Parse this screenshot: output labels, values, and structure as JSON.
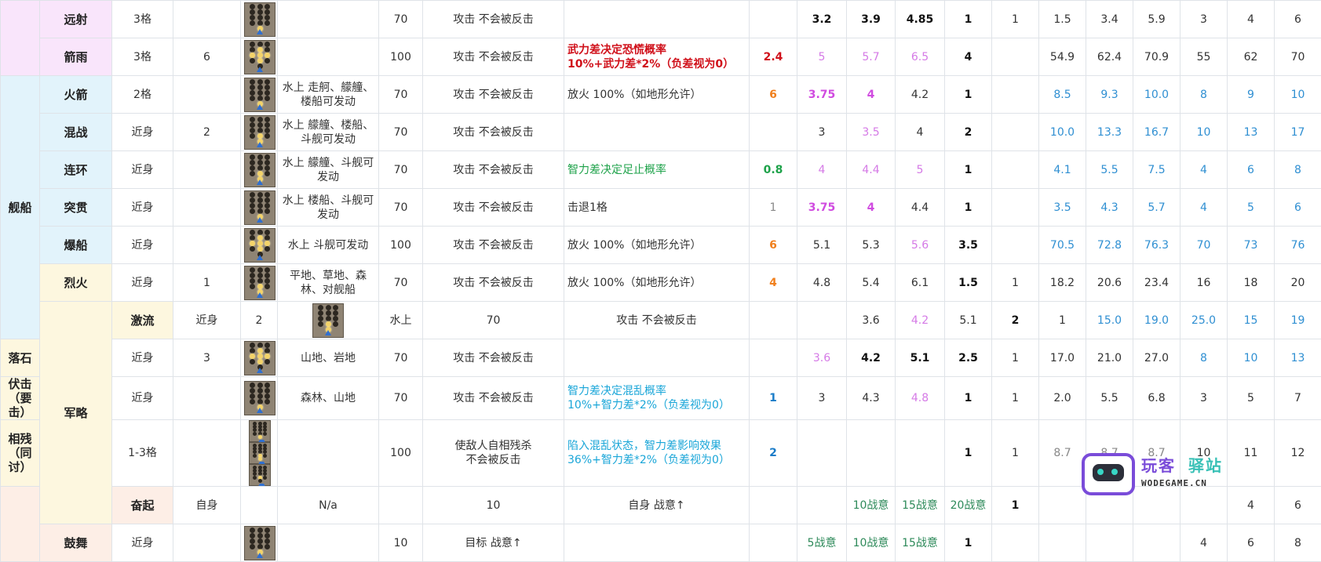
{
  "rows": [
    {
      "cat": "",
      "cat_span": 0,
      "name": "远射",
      "range": "3格",
      "v": "",
      "terr": "",
      "cost": "70",
      "eff": "攻击 不会被反击",
      "desc": "",
      "desc_color": "c-default",
      "coef": "",
      "coef_color": "c-default",
      "a": "3.2",
      "a_c": "c-bold",
      "b": "3.9",
      "b_c": "c-bold",
      "c": "4.85",
      "c_c": "c-bold",
      "d": "1",
      "e": "1",
      "f": "1.5",
      "f_c": "c-dark",
      "g": "3.4",
      "g_c": "c-dark",
      "h": "5.9",
      "h_c": "c-dark",
      "i": "3",
      "i_c": "c-dark",
      "j": "4",
      "j_c": "c-dark",
      "k": "6",
      "k_c": "c-dark",
      "bg": "pink",
      "img": "std"
    },
    {
      "cat": "",
      "cat_span": 0,
      "name": "箭雨",
      "range": "3格",
      "v": "6",
      "terr": "",
      "cost": "100",
      "eff": "攻击 不会被反击",
      "desc": "武力差决定恐慌概率\n10%+武力差*2%（负差视为0）",
      "desc_color": "c-red",
      "coef": "2.4",
      "coef_color": "c-red2",
      "a": "5",
      "a_c": "c-violet",
      "b": "5.7",
      "b_c": "c-violet",
      "c": "6.5",
      "c_c": "c-violet",
      "d": "4",
      "e": "",
      "f": "54.9",
      "f_c": "c-dark",
      "g": "62.4",
      "g_c": "c-dark",
      "h": "70.9",
      "h_c": "c-dark",
      "i": "55",
      "i_c": "c-dark",
      "j": "62",
      "j_c": "c-dark",
      "k": "70",
      "k_c": "c-dark",
      "bg": "pink",
      "img": "rain"
    },
    {
      "cat": "舰船",
      "cat_span": 7,
      "name": "火箭",
      "range": "2格",
      "v": "",
      "terr": "水上 走舸、艨艟、楼船可发动",
      "cost": "70",
      "eff": "攻击 不会被反击",
      "desc": "放火 100%（如地形允许）",
      "desc_color": "c-default",
      "coef": "6",
      "coef_color": "c-orange",
      "a": "3.75",
      "a_c": "c-violetb",
      "b": "4",
      "b_c": "c-violetb",
      "c": "4.2",
      "c_c": "c-dark",
      "d": "1",
      "e": "",
      "f": "8.5",
      "f_c": "c-blue",
      "g": "9.3",
      "g_c": "c-blue",
      "h": "10.0",
      "h_c": "c-blue",
      "i": "8",
      "i_c": "c-blue",
      "j": "9",
      "j_c": "c-blue",
      "k": "10",
      "k_c": "c-blue",
      "bg": "blue",
      "img": "std"
    },
    {
      "cat": "",
      "cat_span": 0,
      "name": "混战",
      "range": "近身",
      "v": "2",
      "terr": "水上 艨艟、楼船、斗舰可发动",
      "cost": "70",
      "eff": "攻击 不会被反击",
      "desc": "",
      "desc_color": "c-default",
      "coef": "",
      "coef_color": "c-default",
      "a": "3",
      "a_c": "c-dark",
      "b": "3.5",
      "b_c": "c-violet",
      "c": "4",
      "c_c": "c-dark",
      "d": "2",
      "e": "",
      "f": "10.0",
      "f_c": "c-blue",
      "g": "13.3",
      "g_c": "c-blue",
      "h": "16.7",
      "h_c": "c-blue",
      "i": "10",
      "i_c": "c-blue",
      "j": "13",
      "j_c": "c-blue",
      "k": "17",
      "k_c": "c-blue",
      "bg": "blue",
      "img": "mix"
    },
    {
      "cat": "",
      "cat_span": 0,
      "name": "连环",
      "range": "近身",
      "v": "",
      "terr": "水上 艨艟、斗舰可发动",
      "cost": "70",
      "eff": "攻击 不会被反击",
      "desc": "智力差决定足止概率",
      "desc_color": "c-green",
      "coef": "0.8",
      "coef_color": "c-greenb",
      "a": "4",
      "a_c": "c-violet",
      "b": "4.4",
      "b_c": "c-violet",
      "c": "5",
      "c_c": "c-violet",
      "d": "1",
      "e": "",
      "f": "4.1",
      "f_c": "c-blue",
      "g": "5.5",
      "g_c": "c-blue",
      "h": "7.5",
      "h_c": "c-blue",
      "i": "4",
      "i_c": "c-blue",
      "j": "6",
      "j_c": "c-blue",
      "k": "8",
      "k_c": "c-blue",
      "bg": "blue",
      "img": "mix"
    },
    {
      "cat": "",
      "cat_span": 0,
      "name": "突贯",
      "range": "近身",
      "v": "",
      "terr": "水上 楼船、斗舰可发动",
      "cost": "70",
      "eff": "攻击 不会被反击",
      "desc": "击退1格",
      "desc_color": "c-default",
      "coef": "1",
      "coef_color": "c-gray",
      "a": "3.75",
      "a_c": "c-violetb",
      "b": "4",
      "b_c": "c-violetb",
      "c": "4.4",
      "c_c": "c-dark",
      "d": "1",
      "e": "",
      "f": "3.5",
      "f_c": "c-blue",
      "g": "4.3",
      "g_c": "c-blue",
      "h": "5.7",
      "h_c": "c-blue",
      "i": "4",
      "i_c": "c-blue",
      "j": "5",
      "j_c": "c-blue",
      "k": "6",
      "k_c": "c-blue",
      "bg": "blue",
      "img": "std"
    },
    {
      "cat": "",
      "cat_span": 0,
      "name": "爆船",
      "range": "近身",
      "v": "",
      "terr": "水上 斗舰可发动",
      "cost": "100",
      "eff": "攻击 不会被反击",
      "desc": "放火 100%（如地形允许）",
      "desc_color": "c-default",
      "coef": "6",
      "coef_color": "c-orange",
      "a": "5.1",
      "a_c": "c-dark",
      "b": "5.3",
      "b_c": "c-dark",
      "c": "5.6",
      "c_c": "c-violet",
      "d": "3.5",
      "e": "",
      "f": "70.5",
      "f_c": "c-blue",
      "g": "72.8",
      "g_c": "c-blue",
      "h": "76.3",
      "h_c": "c-blue",
      "i": "70",
      "i_c": "c-blue",
      "j": "73",
      "j_c": "c-blue",
      "k": "76",
      "k_c": "c-blue",
      "bg": "blue",
      "img": "rain"
    },
    {
      "cat": "",
      "cat_span": 0,
      "name": "烈火",
      "range": "近身",
      "v": "1",
      "terr": "平地、草地、森林、对舰船",
      "cost": "70",
      "eff": "攻击 不会被反击",
      "desc": "放火 100%（如地形允许）",
      "desc_color": "c-default",
      "coef": "4",
      "coef_color": "c-orange",
      "a": "4.8",
      "a_c": "c-dark",
      "b": "5.4",
      "b_c": "c-dark",
      "c": "6.1",
      "c_c": "c-dark",
      "d": "1.5",
      "e": "1",
      "f": "18.2",
      "f_c": "c-dark",
      "g": "20.6",
      "g_c": "c-dark",
      "h": "23.4",
      "h_c": "c-dark",
      "i": "16",
      "i_c": "c-dark",
      "j": "18",
      "j_c": "c-dark",
      "k": "20",
      "k_c": "c-dark",
      "bg": "yellow",
      "img": "mix"
    },
    {
      "cat": "军略",
      "cat_span": 5,
      "name": "激流",
      "range": "近身",
      "v": "2",
      "terr": "水上",
      "cost": "70",
      "eff": "攻击 不会被反击",
      "desc": "",
      "desc_color": "c-default",
      "coef": "",
      "coef_color": "c-default",
      "a": "3.6",
      "a_c": "c-dark",
      "b": "4.2",
      "b_c": "c-violet",
      "c": "5.1",
      "c_c": "c-dark",
      "d": "2",
      "e": "1",
      "f": "15.0",
      "f_c": "c-blue",
      "g": "19.0",
      "g_c": "c-blue",
      "h": "25.0",
      "h_c": "c-blue",
      "i": "15",
      "i_c": "c-blue",
      "j": "19",
      "j_c": "c-blue",
      "k": "25",
      "k_c": "c-blue",
      "bg": "yellow",
      "img": "mix"
    },
    {
      "cat": "",
      "cat_span": 0,
      "name": "落石",
      "range": "近身",
      "v": "3",
      "terr": "山地、岩地",
      "cost": "70",
      "eff": "攻击 不会被反击",
      "desc": "",
      "desc_color": "c-default",
      "coef": "",
      "coef_color": "c-default",
      "a": "3.6",
      "a_c": "c-violet",
      "b": "4.2",
      "b_c": "c-bold",
      "c": "5.1",
      "c_c": "c-bold",
      "d": "2.5",
      "e": "1",
      "f": "17.0",
      "f_c": "c-dark",
      "g": "21.0",
      "g_c": "c-dark",
      "h": "27.0",
      "h_c": "c-dark",
      "i": "8",
      "i_c": "c-blue",
      "j": "10",
      "j_c": "c-blue",
      "k": "13",
      "k_c": "c-blue",
      "bg": "yellow",
      "img": "rain"
    },
    {
      "cat": "",
      "cat_span": 0,
      "name": "伏击（要击）",
      "range": "近身",
      "v": "",
      "terr": "森林、山地",
      "cost": "70",
      "eff": "攻击 不会被反击",
      "desc": "智力差决定混乱概率\n10%+智力差*2%（负差视为0）",
      "desc_color": "c-cyan",
      "coef": "1",
      "coef_color": "c-blueb",
      "a": "3",
      "a_c": "c-dark",
      "b": "4.3",
      "b_c": "c-dark",
      "c": "4.8",
      "c_c": "c-violet",
      "d": "1",
      "e": "1",
      "f": "2.0",
      "f_c": "c-dark",
      "g": "5.5",
      "g_c": "c-dark",
      "h": "6.8",
      "h_c": "c-dark",
      "i": "3",
      "i_c": "c-dark",
      "j": "5",
      "j_c": "c-dark",
      "k": "7",
      "k_c": "c-dark",
      "bg": "yellow",
      "img": "std"
    },
    {
      "cat": "",
      "cat_span": 0,
      "name": "相残（同讨）",
      "range": "1-3格",
      "v": "",
      "terr": "",
      "cost": "100",
      "eff": "使敌人自相残杀\n不会被反击",
      "desc": "陷入混乱状态，智力差影响效果\n36%+智力差*2%（负差视为0）",
      "desc_color": "c-cyan",
      "coef": "2",
      "coef_color": "c-blueb",
      "a": "",
      "a_c": "c-dark",
      "b": "",
      "b_c": "c-dark",
      "c": "",
      "c_c": "c-dark",
      "d": "1",
      "e": "1",
      "f": "8.7",
      "f_c": "c-gray",
      "g": "8.7",
      "g_c": "c-gray",
      "h": "8.7",
      "h_c": "c-gray",
      "i": "10",
      "i_c": "c-dark",
      "j": "11",
      "j_c": "c-dark",
      "k": "12",
      "k_c": "c-dark",
      "bg": "yellow",
      "img": "triple"
    },
    {
      "cat": "",
      "cat_span": 2,
      "name": "奋起",
      "range": "自身",
      "v": "",
      "terr": "",
      "cost": "10",
      "eff": "自身 战意↑",
      "desc": "",
      "desc_color": "c-default",
      "coef": "",
      "coef_color": "c-default",
      "a": "10战意",
      "a_c": "c-teal",
      "b": "15战意",
      "b_c": "c-teal",
      "c": "20战意",
      "c_c": "c-teal",
      "d": "1",
      "e": "",
      "f": "",
      "f_c": "c-dark",
      "g": "",
      "g_c": "c-dark",
      "h": "",
      "h_c": "c-dark",
      "i": "4",
      "i_c": "c-dark",
      "j": "6",
      "j_c": "c-dark",
      "k": "8",
      "k_c": "c-dark",
      "bg": "peach",
      "img": "na",
      "img_text": "N/a"
    },
    {
      "cat": "",
      "cat_span": 0,
      "name": "鼓舞",
      "range": "近身",
      "v": "",
      "terr": "",
      "cost": "10",
      "eff": "目标 战意↑",
      "desc": "",
      "desc_color": "c-default",
      "coef": "",
      "coef_color": "c-default",
      "a": "5战意",
      "a_c": "c-teal",
      "b": "10战意",
      "b_c": "c-teal",
      "c": "15战意",
      "c_c": "c-teal",
      "d": "1",
      "e": "",
      "f": "",
      "f_c": "c-dark",
      "g": "",
      "g_c": "c-dark",
      "h": "",
      "h_c": "c-dark",
      "i": "4",
      "i_c": "c-dark",
      "j": "6",
      "j_c": "c-dark",
      "k": "8",
      "k_c": "c-dark",
      "bg": "peach",
      "img": "std"
    }
  ],
  "logo": {
    "brand_a": "玩客",
    "brand_b": "驿站",
    "domain": "WODEGAME.CN",
    "icon": "robot-logo-icon"
  }
}
